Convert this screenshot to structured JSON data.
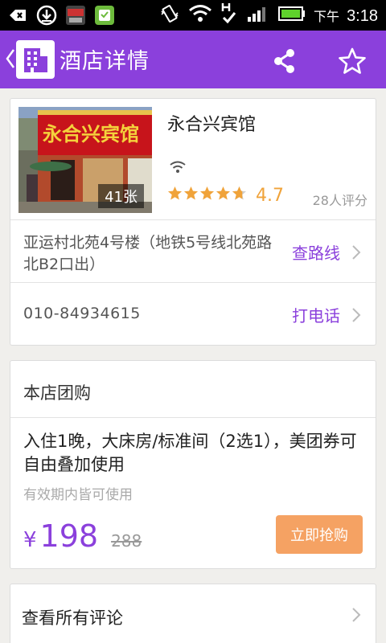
{
  "status_bar": {
    "ampm": "下午",
    "time": "3:18",
    "notification_icons": [
      "adb-icon",
      "download-icon",
      "wifi-app-icon",
      "market-icon"
    ],
    "system_icons": [
      "vibrate-icon",
      "wifi-icon",
      "signal-icon",
      "battery-icon"
    ]
  },
  "header": {
    "title": "酒店详情",
    "background_color": "#8b40dc"
  },
  "hotel": {
    "photo_count": "41张",
    "name": "永合兴宾馆",
    "rating": "4.7",
    "rating_value": 4.7,
    "stars_total": 5,
    "review_count": "28人评分",
    "address": "亚运村北苑4号楼（地铁5号线北苑路北B2口出）",
    "route_label": "查路线",
    "phone": "010-84934615",
    "call_label": "打电话"
  },
  "group_buy": {
    "section_title": "本店团购",
    "deal_title": "入住1晚，大床房/标准间（2选1），美团券可自由叠加使用",
    "validity": "有效期内皆可使用",
    "currency": "¥",
    "price": "198",
    "original_price": "288",
    "buy_label": "立即抢购",
    "buy_color": "#f5a263"
  },
  "reviews_link": {
    "label": "查看所有评论"
  }
}
